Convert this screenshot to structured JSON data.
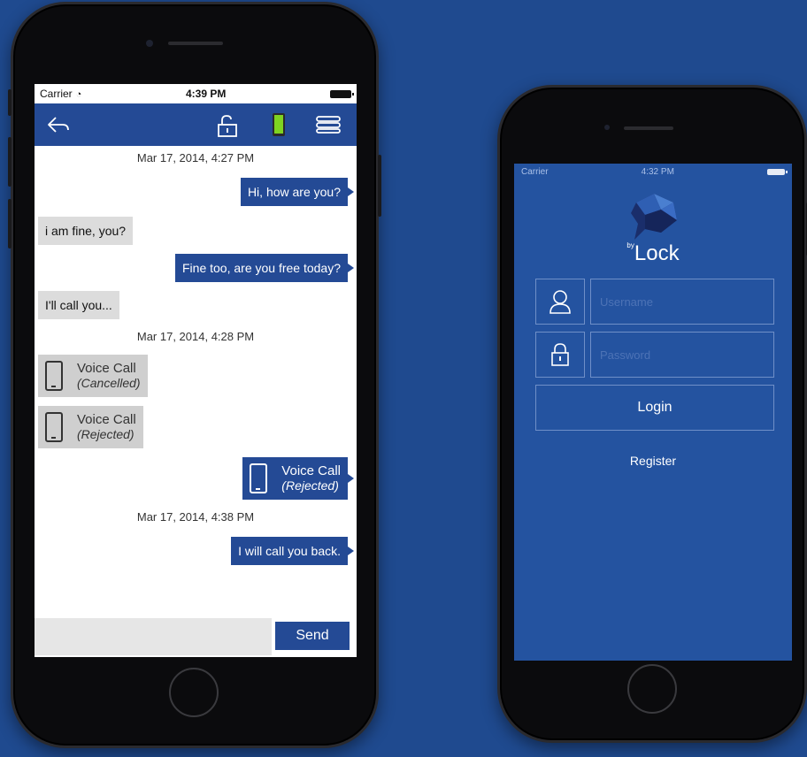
{
  "background_color": "#1f4a8f",
  "accent_color": "#244a95",
  "chat_screen": {
    "status_bar": {
      "carrier": "Carrier",
      "time": "4:39 PM"
    },
    "nav_icons": [
      "back-arrow-icon",
      "unlock-icon",
      "phone-status-icon",
      "menu-icon"
    ],
    "messages": [
      {
        "type": "timestamp",
        "text": "Mar 17, 2014, 4:27 PM"
      },
      {
        "type": "outgoing",
        "text": "Hi, how are you?"
      },
      {
        "type": "incoming",
        "text": "i am fine, you?"
      },
      {
        "type": "outgoing",
        "text": "Fine too, are you free today?"
      },
      {
        "type": "incoming",
        "text": "I'll call you..."
      },
      {
        "type": "timestamp",
        "text": "Mar 17, 2014, 4:28 PM"
      },
      {
        "type": "incoming_call",
        "title": "Voice Call",
        "status": "(Cancelled)"
      },
      {
        "type": "incoming_call",
        "title": "Voice Call",
        "status": "(Rejected)"
      },
      {
        "type": "outgoing_call",
        "title": "Voice Call",
        "status": "(Rejected)"
      },
      {
        "type": "timestamp",
        "text": "Mar 17, 2014, 4:38 PM"
      },
      {
        "type": "outgoing",
        "text": "I will call you back."
      }
    ],
    "composer": {
      "value": "",
      "send_label": "Send"
    }
  },
  "login_screen": {
    "status_bar": {
      "carrier": "Carrier",
      "time": "4:32 PM"
    },
    "brand_prefix": "by",
    "brand_name": "Lock",
    "username_placeholder": "Username",
    "password_placeholder": "Password",
    "login_label": "Login",
    "register_label": "Register"
  }
}
